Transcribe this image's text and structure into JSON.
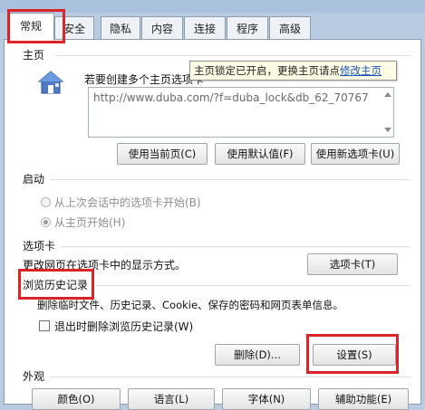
{
  "tabs": [
    {
      "label": "常规",
      "active": true
    },
    {
      "label": "安全"
    },
    {
      "label": "隐私"
    },
    {
      "label": "内容"
    },
    {
      "label": "连接"
    },
    {
      "label": "程序"
    },
    {
      "label": "高级"
    }
  ],
  "home": {
    "title": "主页",
    "instruction": "若要创建多个主页选项卡",
    "tooltip_text": "主页锁定已开启，更换主页请点",
    "tooltip_link": "修改主页",
    "url_value": "http://www.duba.com/?f=duba_lock&db_62_70767",
    "btn_current": "使用当前页(C)",
    "btn_default": "使用默认值(F)",
    "btn_newtab": "使用新选项卡(U)"
  },
  "startup": {
    "title": "启动",
    "option_last": "从上次会话中的选项卡开始(B)",
    "option_home": "从主页开始(H)",
    "selected": "option_home"
  },
  "tabs_group": {
    "title": "选项卡",
    "desc": "更改网页在选项卡中的显示方式。",
    "btn": "选项卡(T)"
  },
  "history": {
    "title": "浏览历史记录",
    "desc": "删除临时文件、历史记录、Cookie、保存的密码和网页表单信息。",
    "checkbox_label": "退出时删除浏览历史记录(W)",
    "checkbox_checked": false,
    "btn_delete": "删除(D)...",
    "btn_settings": "设置(S)"
  },
  "appearance": {
    "title": "外观",
    "btn_colors": "颜色(O)",
    "btn_languages": "语言(L)",
    "btn_fonts": "字体(N)",
    "btn_accessibility": "辅助功能(E)"
  },
  "colors": {
    "highlight_red": "#d9252a",
    "link_blue": "#1a56b8",
    "tooltip_bg": "#fffde6",
    "window_frame": "#b9cbe0"
  }
}
